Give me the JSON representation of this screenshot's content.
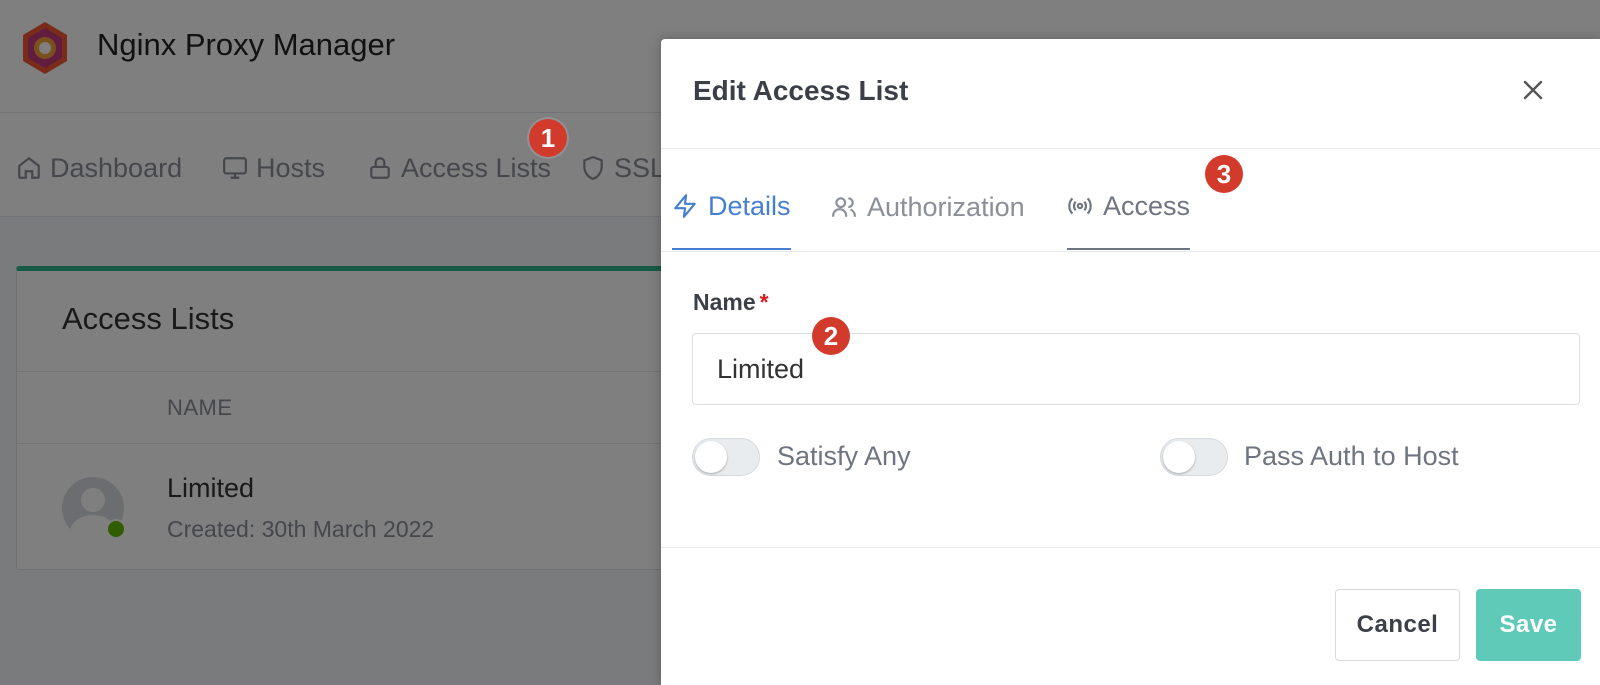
{
  "app": {
    "title": "Nginx Proxy Manager"
  },
  "nav": {
    "items": [
      {
        "label": "Dashboard",
        "icon": "home-icon"
      },
      {
        "label": "Hosts",
        "icon": "monitor-icon"
      },
      {
        "label": "Access Lists",
        "icon": "lock-icon"
      },
      {
        "label": "SSL",
        "icon": "shield-icon"
      }
    ]
  },
  "card": {
    "title": "Access Lists",
    "column_header": "NAME",
    "rows": [
      {
        "name": "Limited",
        "created": "Created: 30th March 2022",
        "status": "online"
      }
    ]
  },
  "modal": {
    "title": "Edit Access List",
    "close_icon": "close-icon",
    "tabs": [
      {
        "label": "Details",
        "icon": "zap-icon",
        "state": "active"
      },
      {
        "label": "Authorization",
        "icon": "users-icon",
        "state": "inactive"
      },
      {
        "label": "Access",
        "icon": "radio-icon",
        "state": "hovered"
      }
    ],
    "name_label": "Name",
    "name_required_mark": "*",
    "name_value": "Limited",
    "satisfy_any_label": "Satisfy Any",
    "satisfy_any_on": false,
    "pass_auth_label": "Pass Auth to Host",
    "pass_auth_on": false,
    "cancel_label": "Cancel",
    "save_label": "Save"
  },
  "annotations": [
    "1",
    "2",
    "3"
  ],
  "colors": {
    "accent": "#467fcf",
    "save": "#5fcab8",
    "badge": "#d23a2b",
    "card_top": "#2fb48c",
    "online": "#5eba00"
  }
}
